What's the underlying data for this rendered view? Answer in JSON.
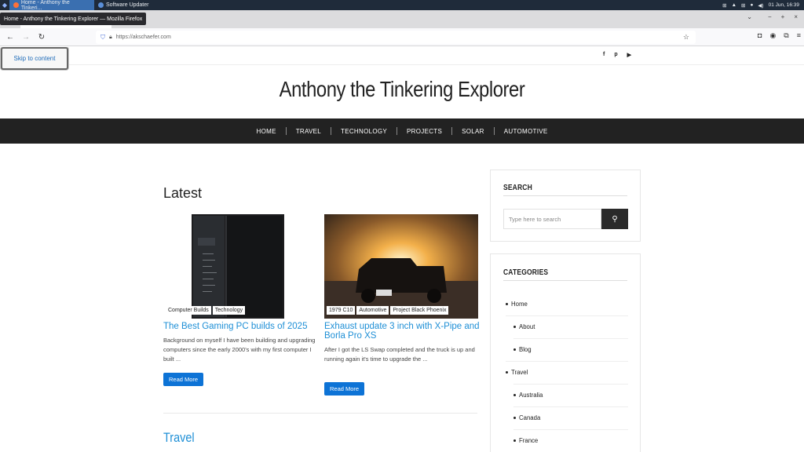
{
  "taskbar": {
    "active_task": "Home - Anthony the Tinkeri...",
    "other_task": "Software Updater",
    "datetime": "01 Jun, 16:39"
  },
  "browser": {
    "tooltip": "Home - Anthony the Tinkering Explorer — Mozilla Firefox",
    "url": "https://akschaefer.com"
  },
  "page": {
    "skip_link": "Skip to content",
    "site_title": "Anthony the Tinkering Explorer",
    "social_icons": [
      "f",
      "p",
      "▶"
    ],
    "nav": [
      "HOME",
      "TRAVEL",
      "TECHNOLOGY",
      "PROJECTS",
      "SOLAR",
      "AUTOMOTIVE"
    ],
    "latest_heading": "Latest",
    "posts": [
      {
        "categories": [
          "Computer Builds",
          "Technology"
        ],
        "title": "The Best Gaming PC builds of 2025",
        "excerpt": "Background on myself I have been building and upgrading computers since the early 2000's with my first computer I built ...",
        "read_more": "Read More"
      },
      {
        "categories": [
          "1979 C10",
          "Automotive",
          "Project Black Phoenix"
        ],
        "title": "Exhaust update 3 inch with X-Pipe and Borla Pro XS",
        "excerpt": "After I got the LS Swap completed and the truck is up and running again it's time to upgrade the ...",
        "read_more": "Read More"
      }
    ],
    "section_heading": "Travel"
  },
  "sidebar": {
    "search_title": "SEARCH",
    "search_placeholder": "Type here to search",
    "categories_title": "CATEGORIES",
    "categories": [
      "Home",
      "About",
      "Blog",
      "Travel",
      "Australia",
      "Canada",
      "France"
    ]
  }
}
